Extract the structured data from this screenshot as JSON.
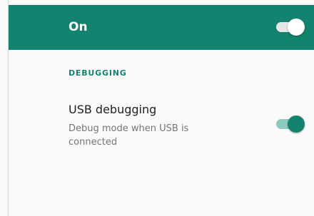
{
  "master": {
    "label": "On",
    "checked": true
  },
  "section": {
    "header": "DEBUGGING"
  },
  "usb_debugging": {
    "title": "USB debugging",
    "summary": "Debug mode when USB is connected",
    "checked": true
  },
  "colors": {
    "accent": "#13836f",
    "background": "#fafafa",
    "title_text": "#212121",
    "summary_text": "#757575"
  },
  "icons": {
    "switch": "toggle-switch"
  }
}
